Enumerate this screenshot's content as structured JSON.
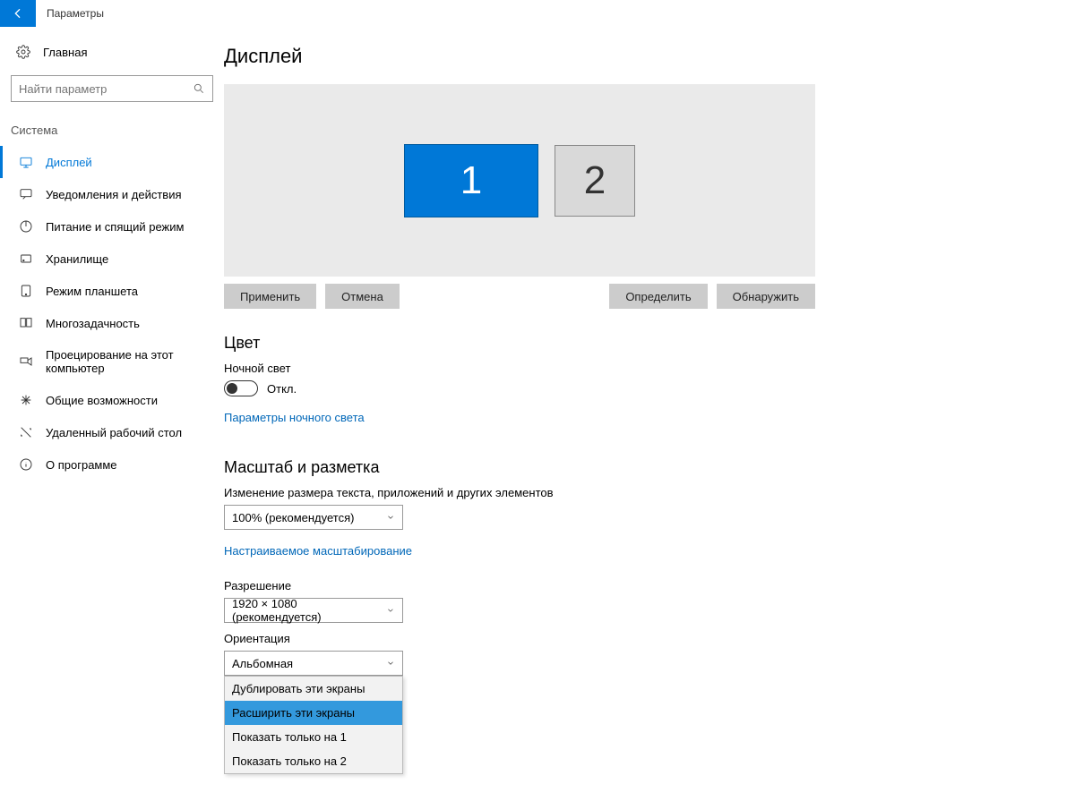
{
  "app_title": "Параметры",
  "home_label": "Главная",
  "search_placeholder": "Найти параметр",
  "category_label": "Система",
  "sidebar": {
    "items": [
      {
        "label": "Дисплей"
      },
      {
        "label": "Уведомления и действия"
      },
      {
        "label": "Питание и спящий режим"
      },
      {
        "label": "Хранилище"
      },
      {
        "label": "Режим планшета"
      },
      {
        "label": "Многозадачность"
      },
      {
        "label": "Проецирование на этот компьютер"
      },
      {
        "label": "Общие возможности"
      },
      {
        "label": "Удаленный рабочий стол"
      },
      {
        "label": "О программе"
      }
    ]
  },
  "page_title": "Дисплей",
  "monitors": {
    "m1": "1",
    "m2": "2"
  },
  "buttons": {
    "apply": "Применить",
    "cancel": "Отмена",
    "identify": "Определить",
    "detect": "Обнаружить"
  },
  "color_section": "Цвет",
  "night_light_label": "Ночной свет",
  "toggle_off": "Откл.",
  "night_light_settings_link": "Параметры ночного света",
  "scale_section": "Масштаб и разметка",
  "scale_label": "Изменение размера текста, приложений и других элементов",
  "scale_value": "100% (рекомендуется)",
  "scale_link": "Настраиваемое масштабирование",
  "resolution_label": "Разрешение",
  "resolution_value": "1920 × 1080 (рекомендуется)",
  "orientation_label": "Ориентация",
  "orientation_value": "Альбомная",
  "multi_display_options": [
    "Дублировать эти экраны",
    "Расширить эти экраны",
    "Показать только на 1",
    "Показать только на 2"
  ]
}
